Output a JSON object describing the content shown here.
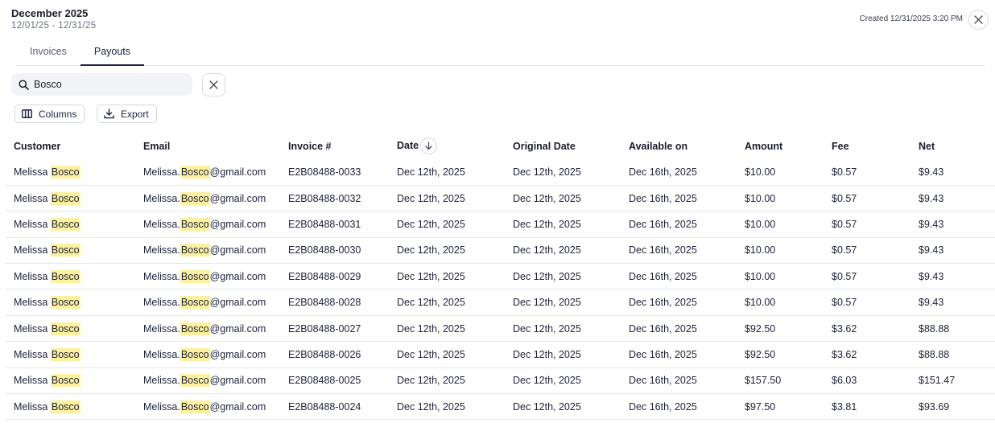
{
  "header": {
    "title": "December 2025",
    "date_range": "12/01/25 - 12/31/25",
    "created": "Created 12/31/2025 3:20 PM"
  },
  "tabs": [
    {
      "label": "Invoices",
      "active": false
    },
    {
      "label": "Payouts",
      "active": true
    }
  ],
  "search": {
    "value": "Bosco",
    "placeholder": ""
  },
  "toolbar": {
    "columns_label": "Columns",
    "export_label": "Export"
  },
  "table": {
    "columns": [
      "Customer",
      "Email",
      "Invoice #",
      "Date",
      "Original Date",
      "Available on",
      "Amount",
      "Fee",
      "Net"
    ],
    "sorted_column": "Date",
    "sort_direction": "desc",
    "highlight_color": "#fdf1a0",
    "rows": [
      {
        "customer_first": "Melissa",
        "customer_last": "Bosco",
        "email_prefix": "Melissa.",
        "email_match": "Bosco",
        "email_suffix": "@gmail.com",
        "invoice": "E2B08488-0033",
        "date": "Dec 12th, 2025",
        "original_date": "Dec 12th, 2025",
        "available_on": "Dec 16th, 2025",
        "amount": "$10.00",
        "fee": "$0.57",
        "net": "$9.43"
      },
      {
        "customer_first": "Melissa",
        "customer_last": "Bosco",
        "email_prefix": "Melissa.",
        "email_match": "Bosco",
        "email_suffix": "@gmail.com",
        "invoice": "E2B08488-0032",
        "date": "Dec 12th, 2025",
        "original_date": "Dec 12th, 2025",
        "available_on": "Dec 16th, 2025",
        "amount": "$10.00",
        "fee": "$0.57",
        "net": "$9.43"
      },
      {
        "customer_first": "Melissa",
        "customer_last": "Bosco",
        "email_prefix": "Melissa.",
        "email_match": "Bosco",
        "email_suffix": "@gmail.com",
        "invoice": "E2B08488-0031",
        "date": "Dec 12th, 2025",
        "original_date": "Dec 12th, 2025",
        "available_on": "Dec 16th, 2025",
        "amount": "$10.00",
        "fee": "$0.57",
        "net": "$9.43"
      },
      {
        "customer_first": "Melissa",
        "customer_last": "Bosco",
        "email_prefix": "Melissa.",
        "email_match": "Bosco",
        "email_suffix": "@gmail.com",
        "invoice": "E2B08488-0030",
        "date": "Dec 12th, 2025",
        "original_date": "Dec 12th, 2025",
        "available_on": "Dec 16th, 2025",
        "amount": "$10.00",
        "fee": "$0.57",
        "net": "$9.43"
      },
      {
        "customer_first": "Melissa",
        "customer_last": "Bosco",
        "email_prefix": "Melissa.",
        "email_match": "Bosco",
        "email_suffix": "@gmail.com",
        "invoice": "E2B08488-0029",
        "date": "Dec 12th, 2025",
        "original_date": "Dec 12th, 2025",
        "available_on": "Dec 16th, 2025",
        "amount": "$10.00",
        "fee": "$0.57",
        "net": "$9.43"
      },
      {
        "customer_first": "Melissa",
        "customer_last": "Bosco",
        "email_prefix": "Melissa.",
        "email_match": "Bosco",
        "email_suffix": "@gmail.com",
        "invoice": "E2B08488-0028",
        "date": "Dec 12th, 2025",
        "original_date": "Dec 12th, 2025",
        "available_on": "Dec 16th, 2025",
        "amount": "$10.00",
        "fee": "$0.57",
        "net": "$9.43"
      },
      {
        "customer_first": "Melissa",
        "customer_last": "Bosco",
        "email_prefix": "Melissa.",
        "email_match": "Bosco",
        "email_suffix": "@gmail.com",
        "invoice": "E2B08488-0027",
        "date": "Dec 12th, 2025",
        "original_date": "Dec 12th, 2025",
        "available_on": "Dec 16th, 2025",
        "amount": "$92.50",
        "fee": "$3.62",
        "net": "$88.88"
      },
      {
        "customer_first": "Melissa",
        "customer_last": "Bosco",
        "email_prefix": "Melissa.",
        "email_match": "Bosco",
        "email_suffix": "@gmail.com",
        "invoice": "E2B08488-0026",
        "date": "Dec 12th, 2025",
        "original_date": "Dec 12th, 2025",
        "available_on": "Dec 16th, 2025",
        "amount": "$92.50",
        "fee": "$3.62",
        "net": "$88.88"
      },
      {
        "customer_first": "Melissa",
        "customer_last": "Bosco",
        "email_prefix": "Melissa.",
        "email_match": "Bosco",
        "email_suffix": "@gmail.com",
        "invoice": "E2B08488-0025",
        "date": "Dec 12th, 2025",
        "original_date": "Dec 12th, 2025",
        "available_on": "Dec 16th, 2025",
        "amount": "$157.50",
        "fee": "$6.03",
        "net": "$151.47"
      },
      {
        "customer_first": "Melissa",
        "customer_last": "Bosco",
        "email_prefix": "Melissa.",
        "email_match": "Bosco",
        "email_suffix": "@gmail.com",
        "invoice": "E2B08488-0024",
        "date": "Dec 12th, 2025",
        "original_date": "Dec 12th, 2025",
        "available_on": "Dec 16th, 2025",
        "amount": "$97.50",
        "fee": "$3.81",
        "net": "$93.69"
      }
    ]
  },
  "icons": {
    "close": "close-icon",
    "search": "search-icon",
    "clear": "clear-icon",
    "columns": "columns-icon",
    "export": "download-icon",
    "sort": "arrow-down-icon"
  }
}
